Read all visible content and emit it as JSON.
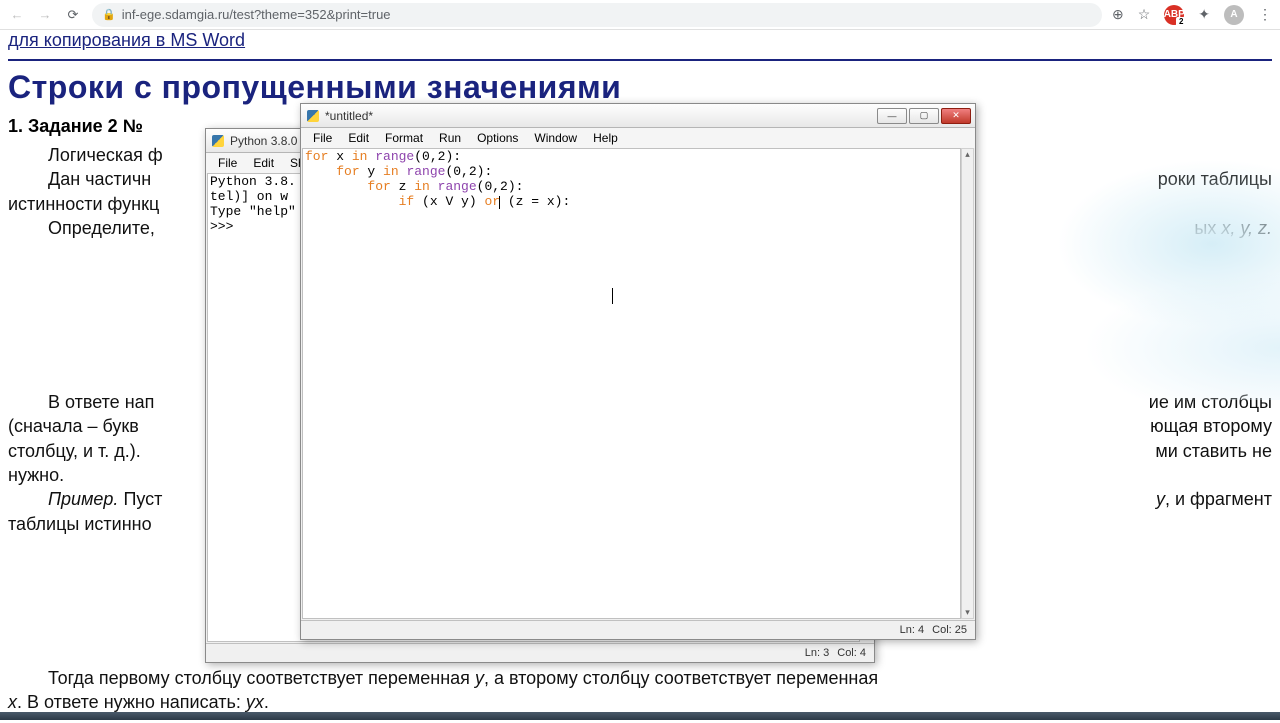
{
  "browser": {
    "url": "inf-ege.sdamgia.ru/test?theme=352&print=true",
    "extension_badge": "ABP",
    "profile_letter": "A"
  },
  "page": {
    "top_link": "для копирования в MS Word",
    "section_title": "Строки с пропущенными значениями",
    "task_title": "1. Задание 2 №",
    "para1": "Логическая ф",
    "para2_a": "Дан   частичн",
    "para2_b": "роки   таблицы",
    "para3": "истинности функц",
    "para4_a": "Определите,",
    "para4_b": "ых ",
    "para4_c": "x, y, z.",
    "para5_a": "В ответе нап",
    "para5_b": "ие им столбцы",
    "para6_a": "(сначала – букв",
    "para6_b": "ющая второму",
    "para7_a": "столбцу, и т. д.).",
    "para7_b": "ми ставить не",
    "para8": "нужно.",
    "para9_a": "Пример.",
    "para9_b": " Пуст",
    "para9_c": ", и фрагмент",
    "para10": "таблицы истинно",
    "para11_a": "Тогда первому столбцу соответствует переменная ",
    "para11_y": "y",
    "para11_b": ", а второму столбцу соответствует переменная ",
    "para12_a": "x",
    "para12_b": ". В ответе нужно написать: ",
    "para12_c": "yx",
    "para12_d": "."
  },
  "shell": {
    "title": "Python 3.8.0",
    "menus": [
      "File",
      "Edit",
      "She"
    ],
    "lines": [
      "Python 3.8.",
      "tel)] on w",
      "Type \"help\"",
      ">>>"
    ],
    "status_ln": "Ln: 3",
    "status_col": "Col: 4"
  },
  "editor": {
    "title": "*untitled*",
    "menus": [
      "File",
      "Edit",
      "Format",
      "Run",
      "Options",
      "Window",
      "Help"
    ],
    "code": {
      "l1_kw1": "for",
      "l1_mid": " x ",
      "l1_kw2": "in",
      "l1_fn": " range",
      "l1_args": "(0,2):",
      "l2_pad": "    ",
      "l2_kw1": "for",
      "l2_mid": " y ",
      "l2_kw2": "in",
      "l2_fn": " range",
      "l2_args": "(0,2):",
      "l3_pad": "        ",
      "l3_kw1": "for",
      "l3_mid": " z ",
      "l3_kw2": "in",
      "l3_fn": " range",
      "l3_args": "(0,2):",
      "l4_pad": "            ",
      "l4_kw1": "if",
      "l4_mid": " (x V y) ",
      "l4_kw2": "or",
      "l4_end": " (z = x):"
    },
    "status_ln": "Ln: 4",
    "status_col": "Col: 25"
  }
}
